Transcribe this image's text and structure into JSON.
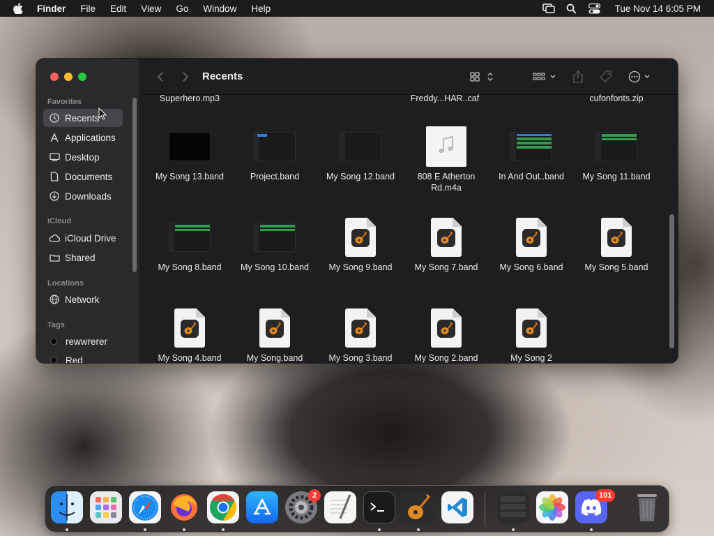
{
  "menubar": {
    "app_name": "Finder",
    "menus": [
      "File",
      "Edit",
      "View",
      "Go",
      "Window",
      "Help"
    ],
    "status_icons": [
      "screen-mirroring-icon",
      "spotlight-search-icon",
      "control-center-icon"
    ],
    "clock": "Tue Nov 14  6:05 PM"
  },
  "window": {
    "title": "Recents",
    "toolbar_icons": [
      "back-icon",
      "forward-icon",
      "icon-view-icon",
      "group-by-icon",
      "share-icon",
      "tag-icon",
      "more-actions-icon",
      "search-icon"
    ]
  },
  "sidebar": {
    "favorites_label": "Favorites",
    "favorites": [
      {
        "label": "Recents",
        "icon": "clock-icon"
      },
      {
        "label": "Applications",
        "icon": "applications-icon"
      },
      {
        "label": "Desktop",
        "icon": "desktop-icon"
      },
      {
        "label": "Documents",
        "icon": "document-icon"
      },
      {
        "label": "Downloads",
        "icon": "downloads-icon"
      }
    ],
    "icloud_label": "iCloud",
    "icloud": [
      {
        "label": "iCloud Drive",
        "icon": "cloud-icon"
      },
      {
        "label": "Shared",
        "icon": "shared-folder-icon"
      }
    ],
    "locations_label": "Locations",
    "locations": [
      {
        "label": "Network",
        "icon": "globe-icon"
      }
    ],
    "tags_label": "Tags",
    "tags": [
      {
        "label": "rewwrerer",
        "color": "#0a0a0a"
      },
      {
        "label": "Red",
        "color": "#0a0a0a"
      }
    ]
  },
  "files": {
    "partial_row": [
      "Superhero.mp3",
      "Freddy...HAR..caf",
      "cufonfonts.zip"
    ],
    "row1": [
      "My Song 13.band",
      "Project.band",
      "My Song 12.band",
      "808 E Atherton\nRd.m4a",
      "In And Out..band",
      "My Song 11.band"
    ],
    "row2": [
      "My Song 8.band",
      "My Song 10.band",
      "My Song 9.band",
      "My Song 7.band",
      "My Song 6.band",
      "My Song 5.band"
    ],
    "row3": [
      "My Song 4.band",
      "My Song.band",
      "My Song 3.band",
      "My Song 2.band",
      "My Song 2"
    ]
  },
  "dock": {
    "apps": [
      "Finder",
      "Launchpad",
      "Safari",
      "Firefox",
      "Chrome",
      "App Store",
      "System Settings",
      "TextEdit",
      "Terminal",
      "GarageBand",
      "Visual Studio Code",
      "Stacks",
      "Photos",
      "Discord",
      "Trash"
    ],
    "badges": {
      "system_settings": "2",
      "discord": "101"
    }
  }
}
